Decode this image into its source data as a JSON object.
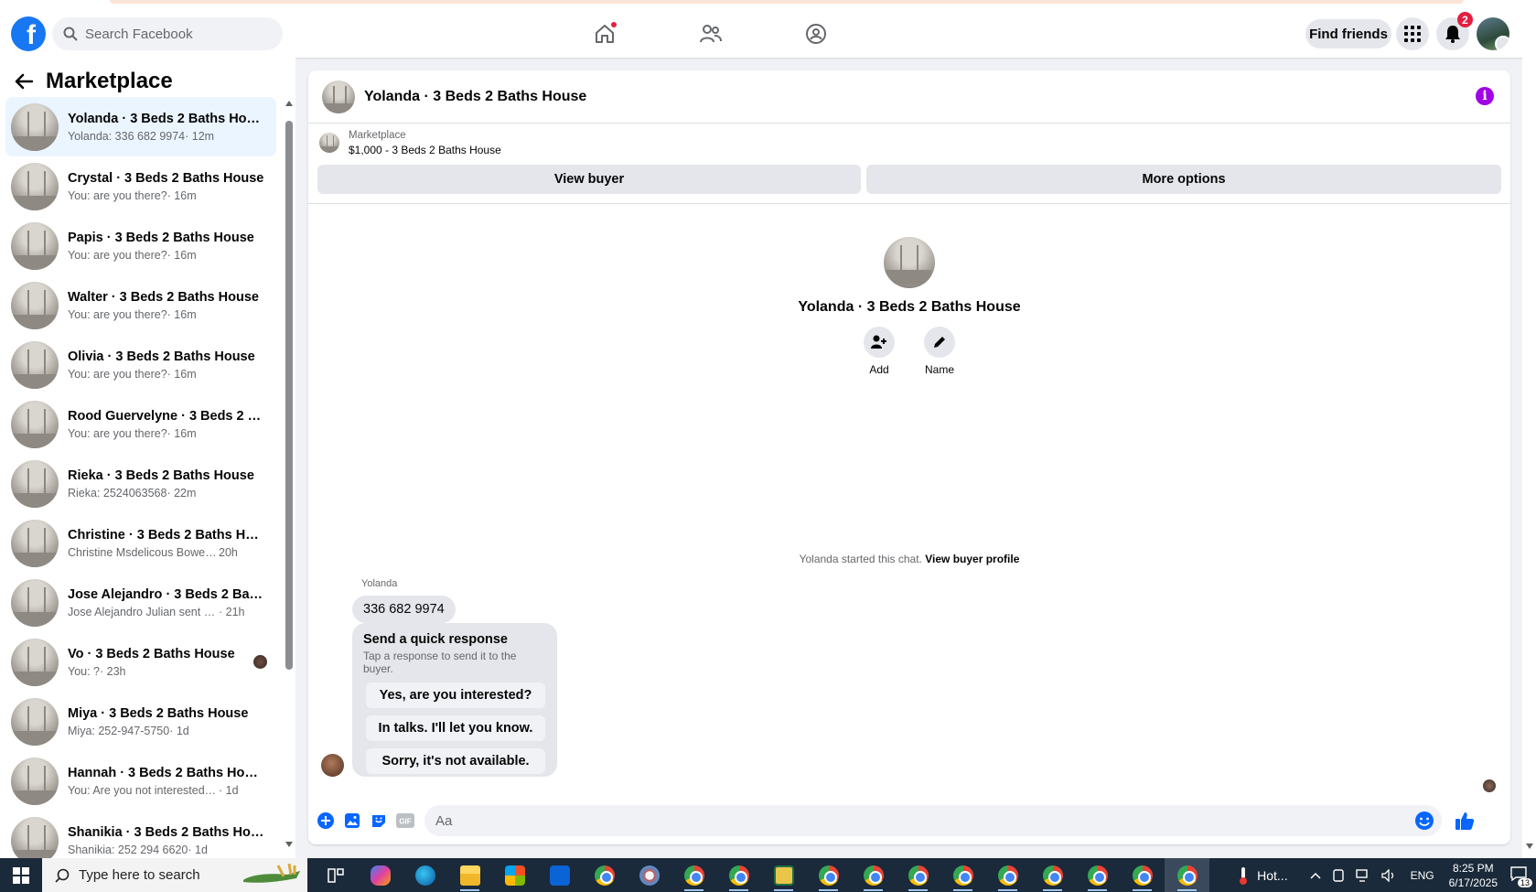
{
  "header": {
    "logo": "f",
    "search_placeholder": "Search Facebook",
    "find_friends": "Find friends",
    "notifications_count": "2"
  },
  "sidebar": {
    "title": "Marketplace",
    "conversations": [
      {
        "name": "Yolanda · 3 Beds 2 Baths House",
        "preview": "Yolanda: 336 682 9974",
        "time": "· 12m",
        "active": true
      },
      {
        "name": "Crystal · 3 Beds 2 Baths House",
        "preview": "You: are you there?",
        "time": "· 16m"
      },
      {
        "name": "Papis · 3 Beds 2 Baths House",
        "preview": "You: are you there?",
        "time": "· 16m"
      },
      {
        "name": "Walter · 3 Beds 2 Baths House",
        "preview": "You: are you there?",
        "time": "· 16m"
      },
      {
        "name": "Olivia · 3 Beds 2 Baths House",
        "preview": "You: are you there?",
        "time": "· 16m"
      },
      {
        "name": "Rood Guervelyne · 3 Beds 2 Bat...",
        "preview": "You: are you there?",
        "time": "· 16m"
      },
      {
        "name": "Rieka · 3 Beds 2 Baths House",
        "preview": "Rieka: 2524063568",
        "time": "· 22m"
      },
      {
        "name": "Christine · 3 Beds 2 Baths House",
        "preview": "Christine Msdelicous Bowers sent ...",
        "time": " 20h"
      },
      {
        "name": "Jose Alejandro · 3 Beds 2 Baths ...",
        "preview": "Jose Alejandro Julian sent you a ...",
        "time": " · 21h"
      },
      {
        "name": "Vo · 3 Beds 2 Baths House",
        "preview": "You: ?",
        "time": "· 23h"
      },
      {
        "name": "Miya · 3 Beds 2 Baths House",
        "preview": "Miya: 252-947-5750",
        "time": "· 1d"
      },
      {
        "name": "Hannah · 3 Beds 2 Baths House",
        "preview": "You: Are you not interested in this ...",
        "time": " · 1d"
      },
      {
        "name": "Shanikia · 3 Beds 2 Baths House",
        "preview": "Shanikia: 252 294 6620",
        "time": "· 1d"
      }
    ]
  },
  "chat": {
    "title": "Yolanda · 3 Beds 2 Baths House",
    "listing_source": "Marketplace",
    "listing_price_title": "$1,000 - 3 Beds 2 Baths House",
    "view_buyer": "View buyer",
    "more_options": "More options",
    "profile_name": "Yolanda · 3 Beds 2 Baths House",
    "add_label": "Add",
    "name_label": "Name",
    "started_text": "Yolanda started this chat.",
    "view_buyer_profile": "View buyer profile",
    "sender": "Yolanda",
    "message": "336 682 9974",
    "quick_title": "Send a quick response",
    "quick_sub": "Tap a response to send it to the buyer.",
    "quick_replies": [
      "Yes, are you interested?",
      "In talks. I'll let you know.",
      "Sorry, it's not available."
    ],
    "composer_placeholder": "Aa",
    "gif": "GIF"
  },
  "taskbar": {
    "search_placeholder": "Type here to search",
    "weather": "Hot...",
    "lang": "ENG",
    "time": "8:25 PM",
    "date": "6/17/2025",
    "notif_count": "13"
  },
  "colors": {
    "brand": "#1877f2",
    "active_item": "#ebf5ff",
    "info": "#a200e6",
    "taskbar": "#1a2a3a"
  }
}
